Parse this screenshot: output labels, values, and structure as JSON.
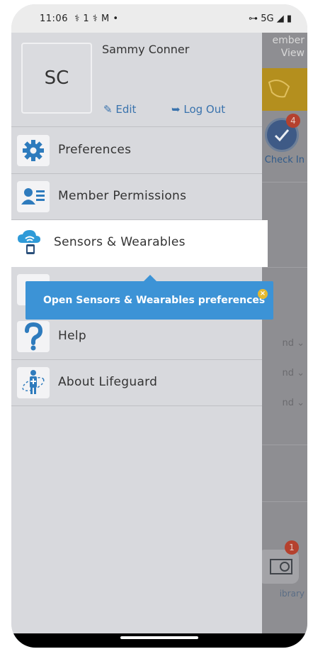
{
  "status_bar": {
    "time": "11:06",
    "icons": "⚕ 1 ⚕ M •",
    "right": "⊶ 5G ◢ ▮"
  },
  "background": {
    "member_view": "ember\nView",
    "checkin_badge": "4",
    "checkin_label": "Check In",
    "row_label": "nd",
    "library_badge": "1",
    "library_label": "ibrary"
  },
  "profile": {
    "initials": "SC",
    "name": "Sammy Conner",
    "edit_label": "Edit",
    "logout_label": "Log Out"
  },
  "menu": [
    {
      "label": "Preferences",
      "icon": "gear-icon"
    },
    {
      "label": "Member Permissions",
      "icon": "member-card-icon"
    },
    {
      "label": "Sensors & Wearables",
      "icon": "cloud-wearable-icon"
    },
    {
      "label": "Help",
      "icon": "question-icon"
    },
    {
      "label": "About Lifeguard",
      "icon": "lifeguard-person-icon"
    }
  ],
  "tooltip": {
    "text": "Open Sensors & Wearables preferences",
    "close": "×"
  },
  "colors": {
    "accent": "#3c93d6",
    "link": "#3a73ad",
    "icon_blue": "#2e7bbd",
    "tooltip_close": "#e6b92e"
  }
}
